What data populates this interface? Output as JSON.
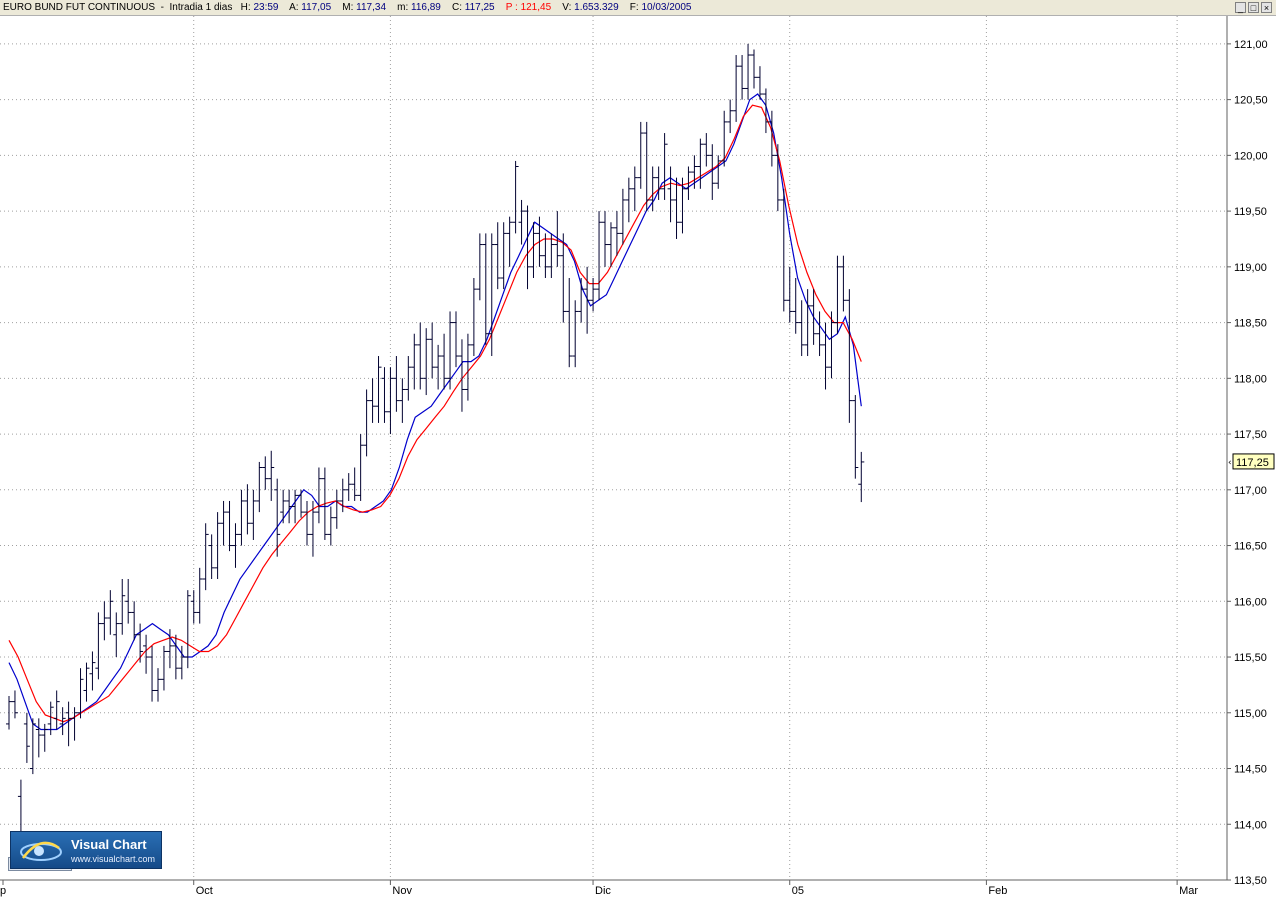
{
  "header": {
    "instrument": "EURO BUND FUT CONTINUOUS",
    "timeframe": "Intradia 1 dias",
    "h_label": "H:",
    "h_value": "23:59",
    "a_label": "A:",
    "a_value": "117,05",
    "m_label": "M:",
    "m_value": "117,34",
    "min_label": "m:",
    "min_value": "116,89",
    "c_label": "C:",
    "c_value": "117,25",
    "p_label": "P :",
    "p_value": "121,45",
    "v_label": "V:",
    "v_value": "1.653.329",
    "f_label": "F:",
    "f_value": "10/03/2005"
  },
  "window_buttons": [
    "_",
    "□",
    "×"
  ],
  "logo": {
    "name": "Visual Chart",
    "url": "www.visualchart.com"
  },
  "colors": {
    "bars": "#000030",
    "fast_ma": "#0000cc",
    "slow_ma": "#ff0000",
    "grid": "#a0a0a0",
    "last_price_bg": "#ffffc0"
  },
  "chart_data": {
    "type": "ohlc",
    "ylim": [
      113.5,
      121.25
    ],
    "y_ticks": [
      "121,00",
      "120,50",
      "120,00",
      "119,50",
      "119,00",
      "118,50",
      "118,00",
      "117,50",
      "117,00",
      "116,50",
      "116,00",
      "115,50",
      "115,00",
      "114,50",
      "114,00",
      "113,50"
    ],
    "y_tick_values": [
      121.0,
      120.5,
      120.0,
      119.5,
      119.0,
      118.5,
      118.0,
      117.5,
      117.0,
      116.5,
      116.0,
      115.5,
      115.0,
      114.5,
      114.0,
      113.5
    ],
    "x_labels": [
      {
        "label": "p",
        "bar": 0
      },
      {
        "label": "Oct",
        "bar": 32
      },
      {
        "label": "Nov",
        "bar": 65
      },
      {
        "label": "Dic",
        "bar": 99
      },
      {
        "label": "05",
        "bar": 132
      },
      {
        "label": "Feb",
        "bar": 165
      },
      {
        "label": "Mar",
        "bar": 197
      }
    ],
    "last_price": "117,25",
    "bars": [
      [
        114.9,
        115.15,
        114.85,
        115.1
      ],
      [
        115.1,
        115.2,
        114.95,
        115.0
      ],
      [
        114.25,
        114.4,
        113.6,
        113.75
      ],
      [
        114.9,
        115.0,
        114.55,
        114.7
      ],
      [
        114.5,
        114.95,
        114.45,
        114.9
      ],
      [
        114.85,
        114.95,
        114.6,
        114.8
      ],
      [
        114.8,
        114.9,
        114.65,
        114.85
      ],
      [
        114.9,
        115.1,
        114.8,
        115.05
      ],
      [
        114.95,
        115.2,
        114.85,
        115.1
      ],
      [
        114.9,
        115.05,
        114.8,
        114.95
      ],
      [
        115.0,
        115.1,
        114.7,
        114.95
      ],
      [
        114.95,
        115.05,
        114.75,
        115.0
      ],
      [
        115.0,
        115.4,
        114.95,
        115.3
      ],
      [
        115.2,
        115.45,
        115.1,
        115.4
      ],
      [
        115.35,
        115.55,
        115.2,
        115.45
      ],
      [
        115.4,
        115.9,
        115.3,
        115.8
      ],
      [
        115.8,
        116.0,
        115.65,
        115.85
      ],
      [
        115.85,
        116.1,
        115.7,
        116.0
      ],
      [
        115.7,
        115.9,
        115.5,
        115.8
      ],
      [
        115.8,
        116.2,
        115.7,
        116.05
      ],
      [
        116.0,
        116.2,
        115.8,
        115.9
      ],
      [
        115.9,
        116.0,
        115.65,
        115.7
      ],
      [
        115.7,
        115.8,
        115.45,
        115.55
      ],
      [
        115.6,
        115.7,
        115.35,
        115.5
      ],
      [
        115.5,
        115.6,
        115.1,
        115.2
      ],
      [
        115.2,
        115.4,
        115.1,
        115.3
      ],
      [
        115.3,
        115.6,
        115.2,
        115.55
      ],
      [
        115.55,
        115.75,
        115.4,
        115.6
      ],
      [
        115.6,
        115.7,
        115.3,
        115.4
      ],
      [
        115.4,
        115.6,
        115.3,
        115.5
      ],
      [
        115.5,
        116.1,
        115.4,
        116.05
      ],
      [
        116.0,
        116.1,
        115.8,
        115.9
      ],
      [
        115.9,
        116.3,
        115.8,
        116.2
      ],
      [
        116.2,
        116.7,
        116.1,
        116.6
      ],
      [
        116.5,
        116.6,
        116.2,
        116.3
      ],
      [
        116.3,
        116.8,
        116.2,
        116.7
      ],
      [
        116.7,
        116.9,
        116.5,
        116.8
      ],
      [
        116.8,
        116.9,
        116.45,
        116.5
      ],
      [
        116.5,
        116.7,
        116.3,
        116.6
      ],
      [
        116.6,
        117.0,
        116.5,
        116.9
      ],
      [
        116.9,
        117.05,
        116.6,
        116.7
      ],
      [
        116.7,
        117.0,
        116.55,
        116.9
      ],
      [
        116.9,
        117.25,
        116.8,
        117.2
      ],
      [
        117.2,
        117.3,
        117.0,
        117.1
      ],
      [
        117.1,
        117.35,
        116.9,
        117.2
      ],
      [
        117.0,
        117.1,
        116.4,
        116.6
      ],
      [
        116.8,
        117.0,
        116.7,
        116.9
      ],
      [
        116.9,
        117.0,
        116.7,
        116.85
      ],
      [
        116.85,
        117.0,
        116.7,
        116.95
      ],
      [
        116.95,
        117.0,
        116.75,
        116.8
      ],
      [
        116.8,
        116.9,
        116.5,
        116.6
      ],
      [
        116.6,
        116.9,
        116.4,
        116.8
      ],
      [
        116.8,
        117.2,
        116.7,
        117.1
      ],
      [
        117.1,
        117.2,
        116.55,
        116.6
      ],
      [
        116.6,
        116.85,
        116.5,
        116.75
      ],
      [
        116.75,
        117.0,
        116.65,
        116.9
      ],
      [
        116.9,
        117.1,
        116.8,
        117.0
      ],
      [
        117.0,
        117.15,
        116.9,
        117.05
      ],
      [
        117.05,
        117.2,
        116.9,
        116.95
      ],
      [
        116.95,
        117.5,
        116.9,
        117.4
      ],
      [
        117.4,
        117.9,
        117.3,
        117.8
      ],
      [
        117.8,
        118.0,
        117.6,
        117.75
      ],
      [
        117.75,
        118.2,
        117.6,
        118.1
      ],
      [
        118.0,
        118.1,
        117.6,
        117.7
      ],
      [
        117.7,
        118.1,
        117.5,
        118.0
      ],
      [
        118.0,
        118.2,
        117.7,
        117.8
      ],
      [
        117.8,
        118.0,
        117.6,
        117.9
      ],
      [
        117.9,
        118.2,
        117.8,
        118.1
      ],
      [
        118.1,
        118.4,
        117.9,
        118.3
      ],
      [
        118.3,
        118.5,
        117.9,
        118.0
      ],
      [
        118.0,
        118.45,
        117.85,
        118.35
      ],
      [
        118.35,
        118.5,
        118.0,
        118.1
      ],
      [
        118.1,
        118.3,
        117.9,
        118.2
      ],
      [
        118.2,
        118.4,
        117.9,
        118.0
      ],
      [
        118.0,
        118.6,
        117.9,
        118.5
      ],
      [
        118.5,
        118.6,
        118.1,
        118.2
      ],
      [
        118.2,
        118.35,
        117.7,
        117.9
      ],
      [
        117.9,
        118.4,
        117.8,
        118.3
      ],
      [
        118.3,
        118.9,
        118.2,
        118.8
      ],
      [
        118.8,
        119.3,
        118.7,
        119.2
      ],
      [
        119.2,
        119.3,
        118.3,
        118.4
      ],
      [
        118.4,
        119.3,
        118.2,
        119.2
      ],
      [
        119.2,
        119.4,
        118.8,
        118.9
      ],
      [
        118.9,
        119.4,
        118.8,
        119.3
      ],
      [
        119.3,
        119.45,
        119.0,
        119.4
      ],
      [
        119.4,
        119.95,
        119.3,
        119.9
      ],
      [
        119.4,
        119.6,
        119.2,
        119.5
      ],
      [
        119.5,
        119.55,
        118.8,
        119.0
      ],
      [
        119.0,
        119.4,
        118.9,
        119.3
      ],
      [
        119.3,
        119.45,
        119.0,
        119.1
      ],
      [
        119.1,
        119.3,
        118.9,
        119.0
      ],
      [
        119.0,
        119.3,
        118.9,
        119.2
      ],
      [
        119.2,
        119.5,
        119.0,
        119.1
      ],
      [
        119.1,
        119.3,
        118.5,
        118.6
      ],
      [
        118.6,
        118.9,
        118.1,
        118.2
      ],
      [
        118.2,
        118.7,
        118.1,
        118.6
      ],
      [
        118.6,
        118.9,
        118.5,
        118.8
      ],
      [
        118.8,
        119.0,
        118.4,
        118.7
      ],
      [
        118.7,
        118.9,
        118.6,
        118.8
      ],
      [
        118.8,
        119.5,
        118.7,
        119.4
      ],
      [
        119.4,
        119.5,
        119.0,
        119.2
      ],
      [
        119.2,
        119.4,
        119.0,
        119.35
      ],
      [
        119.35,
        119.5,
        119.1,
        119.3
      ],
      [
        119.3,
        119.7,
        119.2,
        119.6
      ],
      [
        119.6,
        119.8,
        119.4,
        119.7
      ],
      [
        119.7,
        119.9,
        119.5,
        119.8
      ],
      [
        119.8,
        120.3,
        119.7,
        120.2
      ],
      [
        120.2,
        120.3,
        119.5,
        119.6
      ],
      [
        119.6,
        119.9,
        119.5,
        119.8
      ],
      [
        119.8,
        119.9,
        119.6,
        119.7
      ],
      [
        119.7,
        120.2,
        119.6,
        120.1
      ],
      [
        119.7,
        119.9,
        119.4,
        119.6
      ],
      [
        119.6,
        119.8,
        119.25,
        119.4
      ],
      [
        119.4,
        119.8,
        119.3,
        119.7
      ],
      [
        119.7,
        119.9,
        119.6,
        119.85
      ],
      [
        119.85,
        120.0,
        119.7,
        119.9
      ],
      [
        119.9,
        120.15,
        119.7,
        120.1
      ],
      [
        120.1,
        120.2,
        119.9,
        120.0
      ],
      [
        120.0,
        120.1,
        119.6,
        119.75
      ],
      [
        119.75,
        120.0,
        119.7,
        119.95
      ],
      [
        119.95,
        120.4,
        119.9,
        120.3
      ],
      [
        120.3,
        120.5,
        120.2,
        120.4
      ],
      [
        120.4,
        120.9,
        120.3,
        120.8
      ],
      [
        120.8,
        120.9,
        120.5,
        120.6
      ],
      [
        120.6,
        121.0,
        120.5,
        120.9
      ],
      [
        120.9,
        120.95,
        120.6,
        120.7
      ],
      [
        120.7,
        120.8,
        120.5,
        120.55
      ],
      [
        120.55,
        120.6,
        120.2,
        120.3
      ],
      [
        120.3,
        120.4,
        119.9,
        120.0
      ],
      [
        120.0,
        120.1,
        119.5,
        119.6
      ],
      [
        119.6,
        119.7,
        118.6,
        118.7
      ],
      [
        118.7,
        119.0,
        118.5,
        118.6
      ],
      [
        118.6,
        118.9,
        118.4,
        118.5
      ],
      [
        118.5,
        118.7,
        118.2,
        118.3
      ],
      [
        118.3,
        118.8,
        118.2,
        118.65
      ],
      [
        118.65,
        118.8,
        118.3,
        118.4
      ],
      [
        118.4,
        118.6,
        118.2,
        118.3
      ],
      [
        118.3,
        118.5,
        117.9,
        118.1
      ],
      [
        118.1,
        118.6,
        118.0,
        118.5
      ],
      [
        118.5,
        119.1,
        118.4,
        119.0
      ],
      [
        119.0,
        119.1,
        118.6,
        118.7
      ],
      [
        118.7,
        118.8,
        117.6,
        117.8
      ],
      [
        117.8,
        117.85,
        117.1,
        117.2
      ],
      [
        117.05,
        117.34,
        116.89,
        117.25
      ]
    ],
    "series": [
      {
        "name": "",
        "color": "#0000cc",
        "values": [
          115.45,
          115.3,
          115.1,
          114.9,
          114.85,
          114.85,
          114.85,
          114.9,
          114.95,
          115.0,
          115.05,
          115.1,
          115.2,
          115.3,
          115.4,
          115.55,
          115.7,
          115.75,
          115.8,
          115.75,
          115.7,
          115.6,
          115.5,
          115.5,
          115.55,
          115.6,
          115.7,
          115.9,
          116.05,
          116.2,
          116.3,
          116.4,
          116.5,
          116.6,
          116.7,
          116.8,
          116.9,
          117.0,
          116.95,
          116.85,
          116.85,
          116.9,
          116.85,
          116.85,
          116.8,
          116.8,
          116.85,
          116.9,
          117.0,
          117.2,
          117.45,
          117.65,
          117.7,
          117.75,
          117.85,
          117.95,
          118.05,
          118.15,
          118.15,
          118.2,
          118.35,
          118.55,
          118.75,
          118.95,
          119.1,
          119.25,
          119.4,
          119.35,
          119.3,
          119.25,
          119.2,
          119.05,
          118.8,
          118.65,
          118.7,
          118.75,
          118.9,
          119.05,
          119.2,
          119.35,
          119.5,
          119.6,
          119.75,
          119.8,
          119.75,
          119.7,
          119.75,
          119.8,
          119.85,
          119.9,
          119.95,
          120.1,
          120.3,
          120.5,
          120.55,
          120.45,
          120.2,
          119.8,
          119.3,
          118.9,
          118.7,
          118.55,
          118.45,
          118.35,
          118.4,
          118.55,
          118.3,
          117.75
        ]
      },
      {
        "name": "",
        "color": "#ff0000",
        "values": [
          115.65,
          115.5,
          115.3,
          115.1,
          114.98,
          114.95,
          114.92,
          114.95,
          115.0,
          115.05,
          115.1,
          115.15,
          115.25,
          115.35,
          115.45,
          115.55,
          115.62,
          115.65,
          115.68,
          115.65,
          115.6,
          115.55,
          115.55,
          115.6,
          115.7,
          115.85,
          116.0,
          116.15,
          116.3,
          116.42,
          116.52,
          116.62,
          116.72,
          116.8,
          116.85,
          116.88,
          116.9,
          116.85,
          116.82,
          116.8,
          116.82,
          116.85,
          116.95,
          117.1,
          117.3,
          117.45,
          117.55,
          117.65,
          117.75,
          117.88,
          118.0,
          118.1,
          118.2,
          118.35,
          118.55,
          118.75,
          118.95,
          119.1,
          119.2,
          119.25,
          119.25,
          119.22,
          119.15,
          118.95,
          118.85,
          118.85,
          118.95,
          119.1,
          119.25,
          119.4,
          119.55,
          119.65,
          119.72,
          119.75,
          119.73,
          119.75,
          119.8,
          119.85,
          119.9,
          119.98,
          120.15,
          120.35,
          120.45,
          120.43,
          120.25,
          119.95,
          119.55,
          119.2,
          118.95,
          118.75,
          118.6,
          118.5,
          118.5,
          118.35,
          118.15
        ]
      }
    ]
  }
}
